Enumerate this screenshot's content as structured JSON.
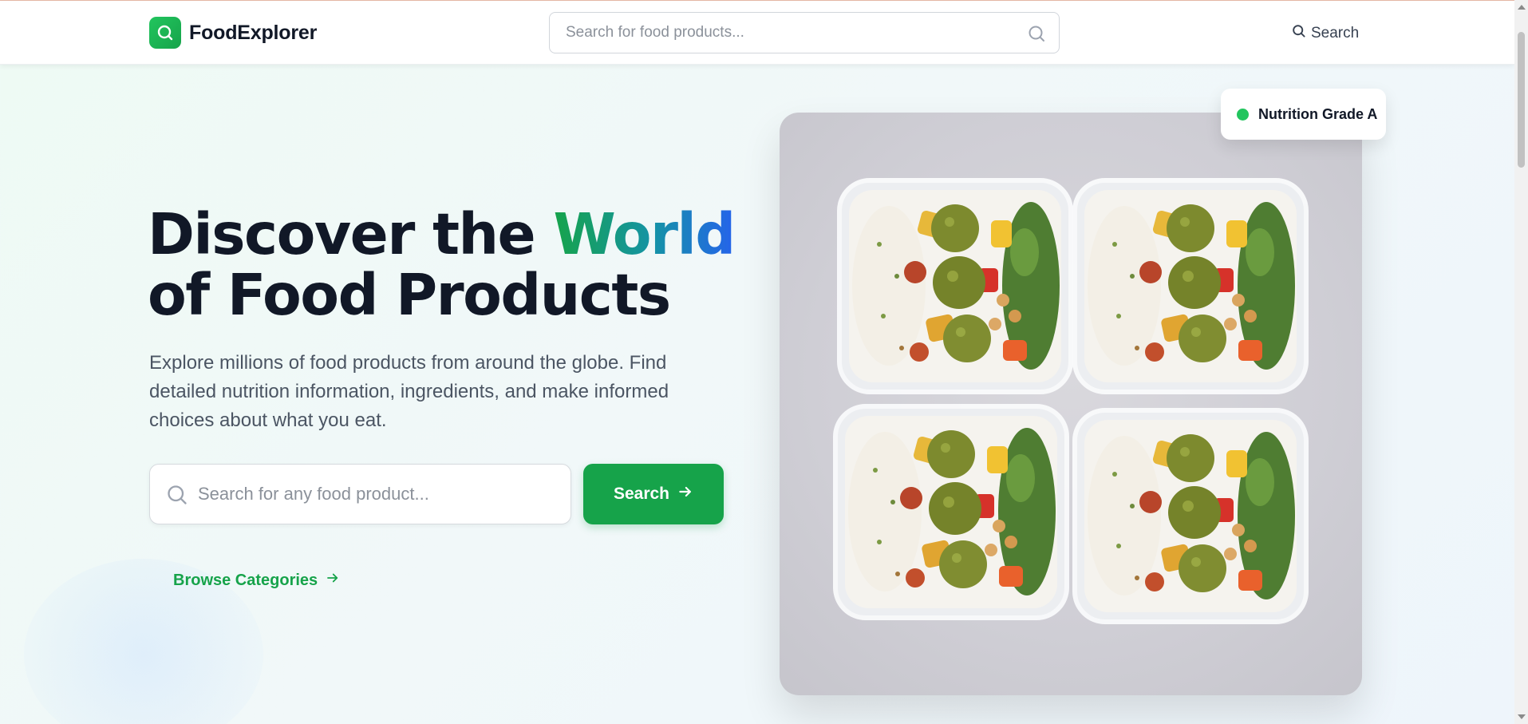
{
  "header": {
    "brand": "FoodExplorer",
    "search_placeholder": "Search for food products...",
    "search_button_label": "Search"
  },
  "hero": {
    "title_line1_prefix": "Discover the ",
    "title_accent": "World",
    "title_line2": "of Food Products",
    "subtitle": "Explore millions of food products from around the globe. Find detailed nutrition information, ingredients, and make informed choices about what you eat.",
    "search_placeholder": "Search for any food product...",
    "search_button_label": "Search",
    "browse_label": "Browse Categories"
  },
  "badge": {
    "label": "Nutrition Grade A",
    "dot_color": "#22c55e"
  },
  "colors": {
    "brand_green": "#16a34a",
    "accent_blue": "#2563eb",
    "text_dark": "#111827"
  },
  "icons": [
    "search-icon",
    "arrow-right-icon",
    "logo-search-icon"
  ]
}
